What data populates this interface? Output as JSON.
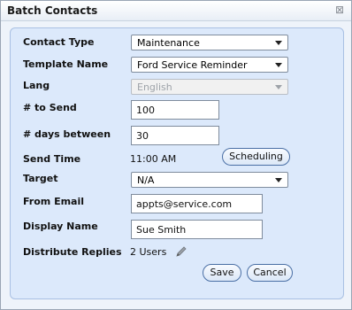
{
  "window": {
    "title": "Batch Contacts",
    "close_glyph": "⊠"
  },
  "form": {
    "contact_type": {
      "label": "Contact Type",
      "value": "Maintenance"
    },
    "template_name": {
      "label": "Template Name",
      "value": "Ford Service Reminder"
    },
    "lang": {
      "label": "Lang",
      "value": "English"
    },
    "num_to_send": {
      "label": "# to Send",
      "value": "100"
    },
    "days_between": {
      "label": "# days between",
      "value": "30"
    },
    "send_time": {
      "label": "Send Time",
      "value": "11:00 AM",
      "button": "Scheduling"
    },
    "target": {
      "label": "Target",
      "value": "N/A"
    },
    "from_email": {
      "label": "From Email",
      "value": "appts@service.com"
    },
    "display_name": {
      "label": "Display Name",
      "value": "Sue Smith"
    },
    "distribute_replies": {
      "label": "Distribute Replies",
      "value": "2 Users"
    }
  },
  "buttons": {
    "save": "Save",
    "cancel": "Cancel"
  }
}
